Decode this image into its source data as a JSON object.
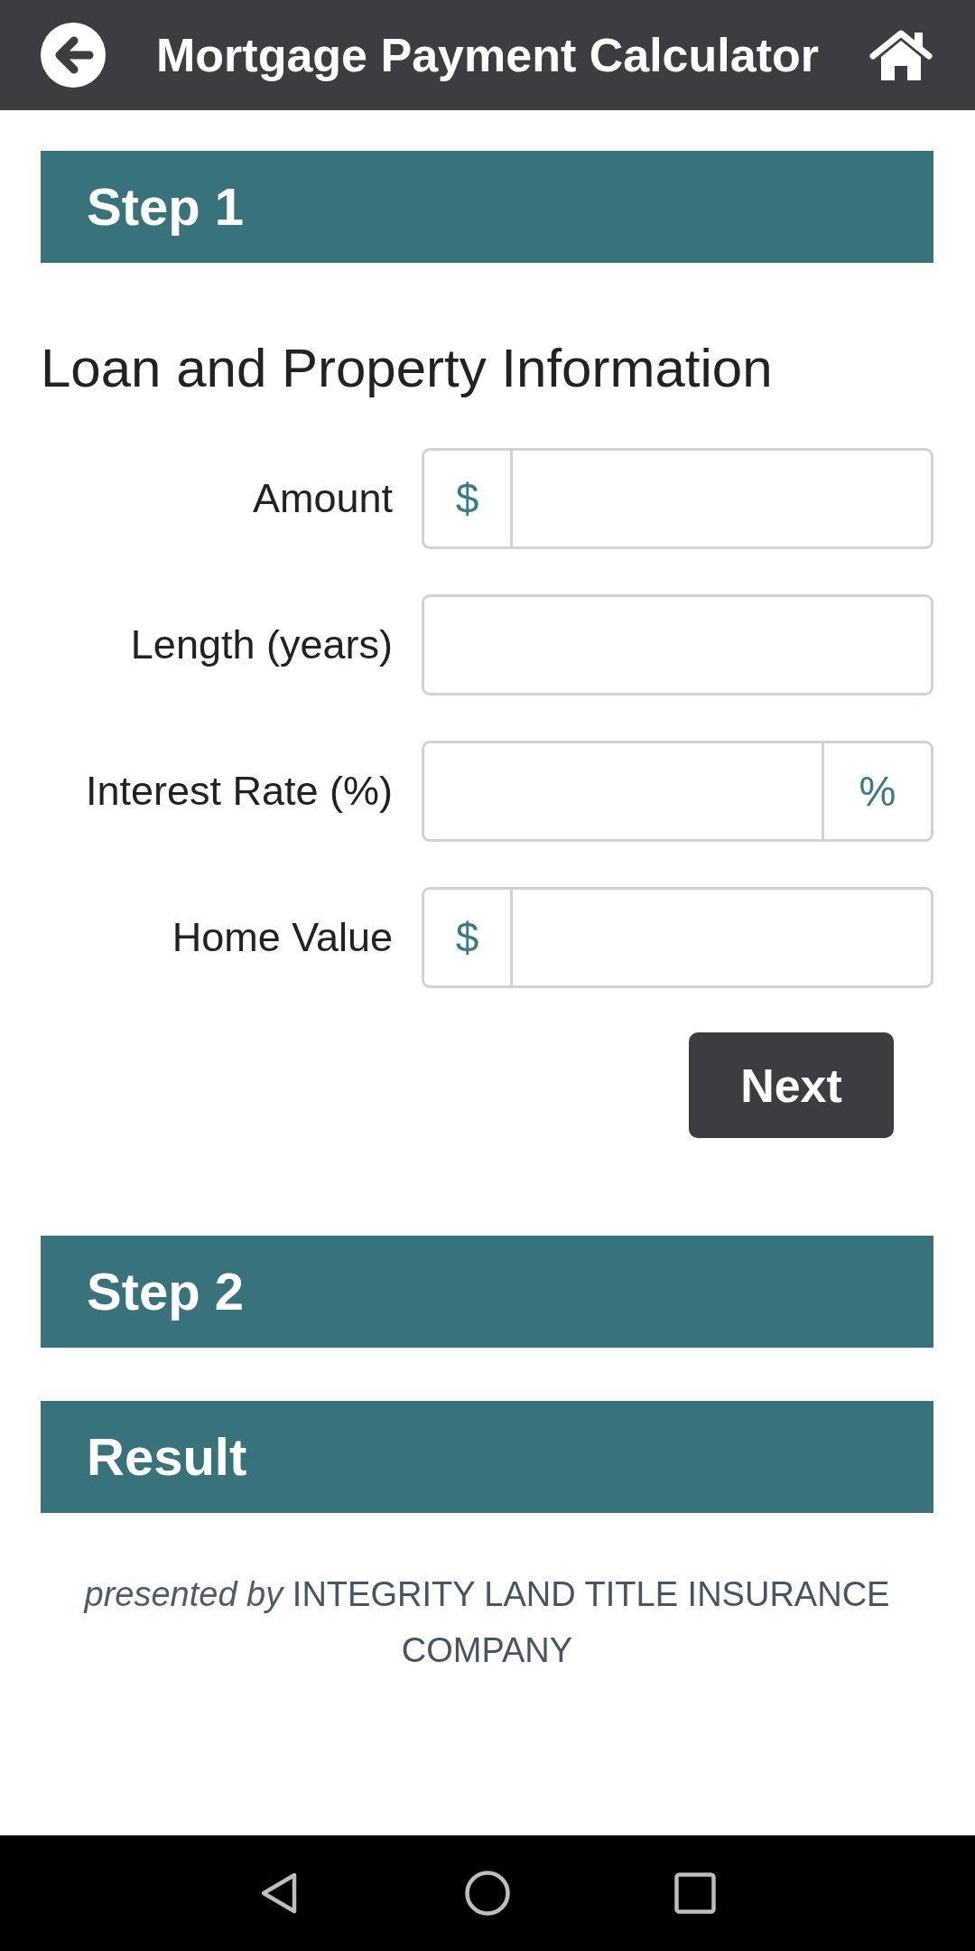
{
  "app_bar": {
    "title": "Mortgage Payment Calculator"
  },
  "sections": [
    {
      "title": "Step 1",
      "heading": "Loan and Property Information",
      "fields": [
        {
          "label": "Amount",
          "prefix": "$"
        },
        {
          "label": "Length (years)"
        },
        {
          "label": "Interest Rate (%)",
          "suffix": "%"
        },
        {
          "label": "Home Value",
          "prefix": "$"
        }
      ],
      "button": "Next"
    },
    {
      "title": "Step 2"
    },
    {
      "title": "Result"
    }
  ],
  "footer": {
    "credit": "*presented by* INTEGRITY LAND TITLE INSURANCE COMPANY"
  }
}
